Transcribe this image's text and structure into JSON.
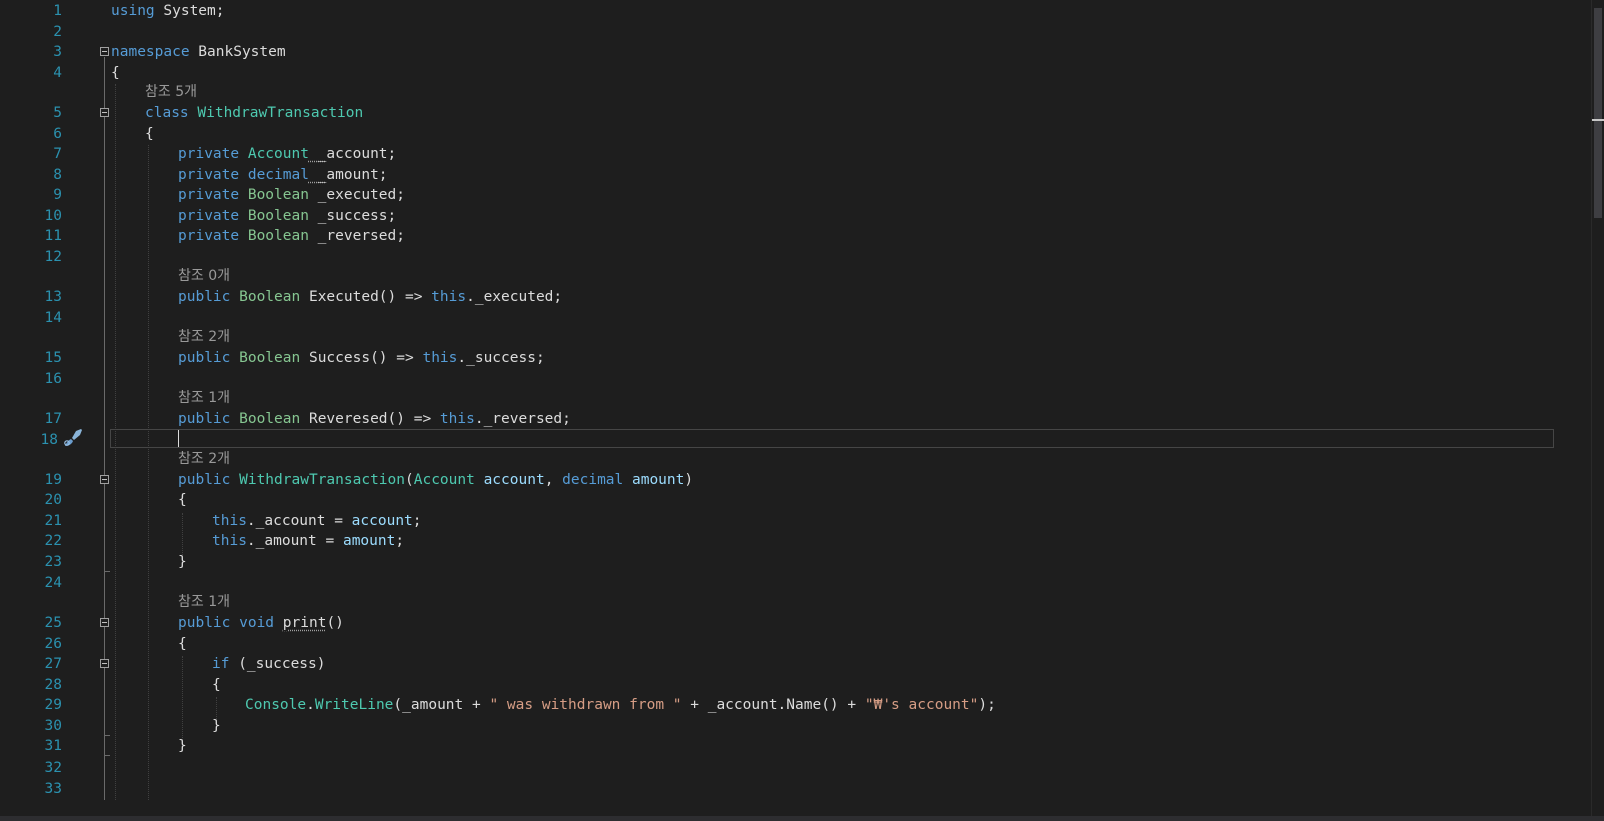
{
  "editor": {
    "cursor_line": 18,
    "codelens": {
      "l5": "참조 5개",
      "l13": "참조 0개",
      "l15": "참조 2개",
      "l17": "참조 1개",
      "l19": "참조 2개",
      "l25": "참조 1개"
    },
    "lines": {
      "l1": {
        "num": "1",
        "k1": "using",
        "t1": " System;"
      },
      "l2": {
        "num": "2"
      },
      "l3": {
        "num": "3",
        "k1": "namespace",
        "t1": " BankSystem"
      },
      "l4": {
        "num": "4",
        "t1": "{"
      },
      "l5": {
        "num": "5",
        "k1": "class",
        "c1": " WithdrawTransaction"
      },
      "l6": {
        "num": "6",
        "t1": "{"
      },
      "l7": {
        "num": "7",
        "k1": "private",
        "c1": " Account",
        " t1": "",
        "s1": " _",
        "t2": "account;"
      },
      "l8": {
        "num": "8",
        "k1": "private",
        "k2": " decimal",
        "s1": " _",
        "t2": "amount;"
      },
      "l9": {
        "num": "9",
        "k1": "private",
        "c1": " Boolean",
        "t1": " _executed;"
      },
      "l10": {
        "num": "10",
        "k1": "private",
        "c1": " Boolean",
        "t1": " _success;"
      },
      "l11": {
        "num": "11",
        "k1": "private",
        "c1": " Boolean",
        "t1": " _reversed;"
      },
      "l12": {
        "num": "12"
      },
      "l13": {
        "num": "13",
        "k1": "public",
        "c1": " Boolean",
        "t1": " Executed() =>",
        "k2": " this",
        "t2": "._executed;"
      },
      "l14": {
        "num": "14"
      },
      "l15": {
        "num": "15",
        "k1": "public",
        "c1": " Boolean",
        "t1": " Success() =>",
        "k2": " this",
        "t2": "._success;"
      },
      "l16": {
        "num": "16"
      },
      "l17": {
        "num": "17",
        "k1": "public",
        "c1": " Boolean",
        "t1": " Reveresed() =>",
        "k2": " this",
        "t2": "._reversed;"
      },
      "l18": {
        "num": "18"
      },
      "l19": {
        "num": "19",
        "k1": "public",
        "c1": " WithdrawTransaction",
        "t1": "(",
        "c2": "Account",
        "p1": " account",
        ",": ",",
        "k2": " decimal",
        "p2": " amount",
        "t2": ")"
      },
      "l20": {
        "num": "20",
        "t1": "{"
      },
      "l21": {
        "num": "21",
        "k1": "this",
        "t1": "._account =",
        "p1": " account",
        ";": ";"
      },
      "l22": {
        "num": "22",
        "k1": "this",
        "t1": "._amount =",
        "p1": " amount",
        ";": ";"
      },
      "l23": {
        "num": "23",
        "t1": "}"
      },
      "l24": {
        "num": "24"
      },
      "l25": {
        "num": "25",
        "k1": "public",
        "k2": " void",
        "t0": " ",
        "s1": "print",
        "t1": "()"
      },
      "l26": {
        "num": "26",
        "t1": "{"
      },
      "l27": {
        "num": "27",
        "k1": "if",
        "t1": " (_success)"
      },
      "l28": {
        "num": "28",
        "t1": "{"
      },
      "l29": {
        "num": "29",
        "c1": "Console",
        "t1": ".",
        "c2": "WriteLine",
        "t2": "(_amount +",
        "s1": " \" was withdrawn from \"",
        "t3": " + _account.Name() +",
        "s2": " \"₩'s account\"",
        "t4": ");"
      },
      "l30": {
        "num": "30",
        "t1": "}"
      },
      "l31": {
        "num": "31",
        "t1": "}"
      },
      "l32": {
        "num": "32"
      },
      "l33": {
        "num": "33"
      }
    }
  },
  "colors": {
    "background": "#1e1e1e",
    "line_number": "#2b91af",
    "keyword": "#569cd6",
    "type": "#4ec9b0",
    "string": "#d69d85",
    "text": "#dcdcdc",
    "codelens": "#999999"
  },
  "icons": {
    "gutter_line18": "paintbrush-icon"
  }
}
